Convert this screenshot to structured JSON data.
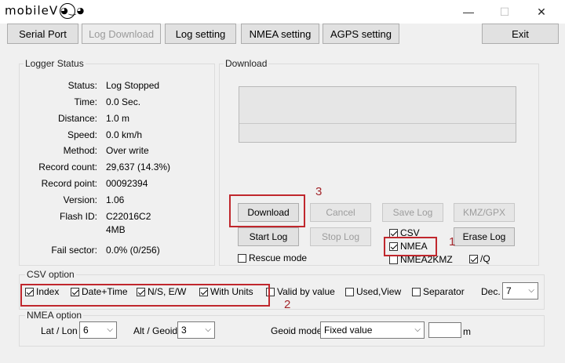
{
  "window": {
    "logo_text": "mobileV",
    "minimize": "—",
    "maximize": "☐",
    "close": "✕"
  },
  "tabs": [
    {
      "label": "Serial Port"
    },
    {
      "label": "Log Download"
    },
    {
      "label": "Log setting"
    },
    {
      "label": "NMEA setting"
    },
    {
      "label": "AGPS setting"
    },
    {
      "label": "Exit"
    }
  ],
  "logger_status": {
    "title": "Logger Status",
    "rows": [
      {
        "label": "Status:",
        "value": "Log Stopped"
      },
      {
        "label": "Time:",
        "value": "0.0 Sec."
      },
      {
        "label": "Distance:",
        "value": "1.0 m"
      },
      {
        "label": "Speed:",
        "value": "0.0 km/h"
      },
      {
        "label": "Method:",
        "value": "Over write"
      },
      {
        "label": "Record count:",
        "value": "29,637 (14.3%)"
      },
      {
        "label": "Record point:",
        "value": "00092394"
      },
      {
        "label": "Version:",
        "value": "1.06"
      },
      {
        "label": "Flash ID:",
        "value": "C22016C2"
      },
      {
        "label": "",
        "value": "4MB"
      },
      {
        "label": "Fail sector:",
        "value": "0.0% (0/256)"
      }
    ]
  },
  "download": {
    "title": "Download",
    "buttons": {
      "download": "Download",
      "cancel": "Cancel",
      "save_log": "Save Log",
      "kmz_gpx": "KMZ/GPX",
      "start_log": "Start Log",
      "stop_log": "Stop Log",
      "erase_log": "Erase Log"
    },
    "checks": {
      "csv": "CSV",
      "nmea": "NMEA",
      "nmea2kmz": "NMEA2KMZ",
      "q": "/Q",
      "rescue": "Rescue mode"
    }
  },
  "csv_option": {
    "title": "CSV option",
    "index": "Index",
    "datetime": "Date+Time",
    "nsew": "N/S, E/W",
    "with_units": "With Units",
    "valid_by_value": "Valid by value",
    "used_view": "Used,View",
    "separator": "Separator",
    "dec_label": "Dec.",
    "dec_value": "7"
  },
  "nmea_option": {
    "title": "NMEA option",
    "lat_lon_label": "Lat / Lon",
    "lat_lon_value": "6",
    "alt_geoid_label": "Alt / Geoid",
    "alt_geoid_value": "3",
    "geoid_model_label": "Geoid model",
    "geoid_model_value": "Fixed value",
    "geoid_unit": "m"
  },
  "annotations": {
    "n1": "1",
    "n2": "2",
    "n3": "3",
    "color": "#c0272d"
  }
}
